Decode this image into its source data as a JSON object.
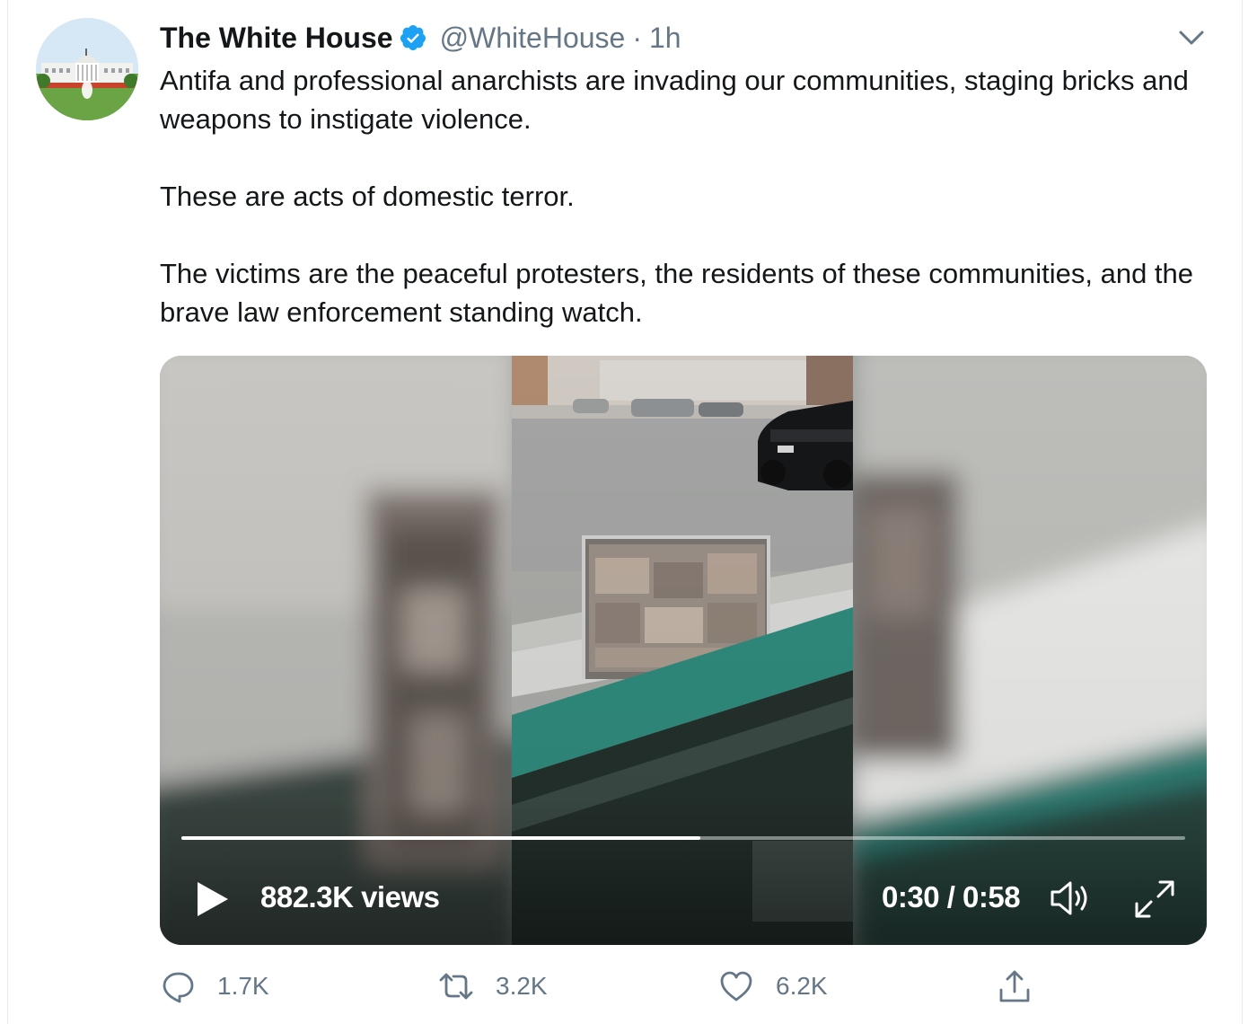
{
  "tweet": {
    "author_name": "The White House",
    "handle": "@WhiteHouse",
    "separator": "·",
    "time": "1h",
    "text": [
      "Antifa and professional anarchists are invading our communities, staging bricks and weapons to instigate violence.",
      "These are acts of domestic terror.",
      "The victims are the peaceful protesters, the residents of these communities, and the brave law enforcement standing watch."
    ]
  },
  "video": {
    "views": "882.3K views",
    "timecode": "0:30 / 0:58",
    "progress": 0.517
  },
  "actions": {
    "reply_count": "1.7K",
    "retweet_count": "3.2K",
    "like_count": "6.2K"
  },
  "colors": {
    "verified": "#1da1f2",
    "secondary_text": "#657786",
    "primary_text": "#14171a",
    "icon": "#657786"
  },
  "icons": {
    "verified": "verified-badge-icon",
    "menu": "chevron-down-icon",
    "play": "play-icon",
    "volume": "volume-icon",
    "fullscreen": "expand-icon",
    "reply": "reply-icon",
    "retweet": "retweet-icon",
    "like": "heart-icon",
    "share": "share-icon"
  }
}
